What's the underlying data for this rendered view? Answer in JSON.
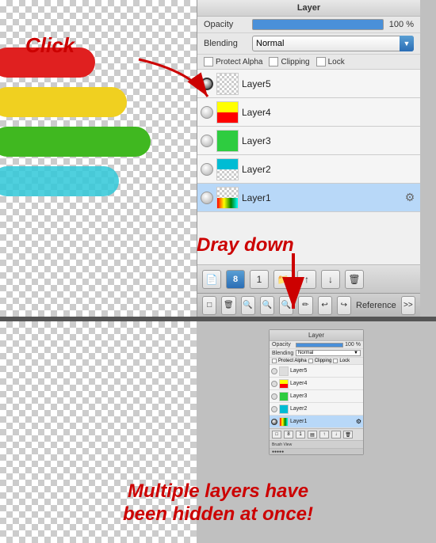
{
  "panel": {
    "title": "Layer",
    "opacity_label": "Opacity",
    "opacity_value": "100 %",
    "blending_label": "Blending",
    "blending_value": "Normal",
    "protect_alpha_label": "Protect Alpha",
    "clipping_label": "Clipping",
    "lock_label": "Lock",
    "layers": [
      {
        "name": "Layer5",
        "selected": false,
        "visible": false,
        "thumb": "white"
      },
      {
        "name": "Layer4",
        "selected": false,
        "visible": false,
        "thumb": "yellow-red"
      },
      {
        "name": "Layer3",
        "selected": false,
        "visible": false,
        "thumb": "green"
      },
      {
        "name": "Layer2",
        "selected": false,
        "visible": false,
        "thumb": "teal"
      },
      {
        "name": "Layer1",
        "selected": true,
        "visible": false,
        "thumb": "multi"
      }
    ]
  },
  "annotations": {
    "click": "Click",
    "drag_down": "Dray down",
    "result": "Multiple layers have\nbeen hidden at once!"
  },
  "reference_bar": {
    "label": "Reference"
  },
  "toolbar_buttons": [
    "new-group",
    "8",
    "1",
    "folder",
    "export",
    "import",
    "delete"
  ]
}
